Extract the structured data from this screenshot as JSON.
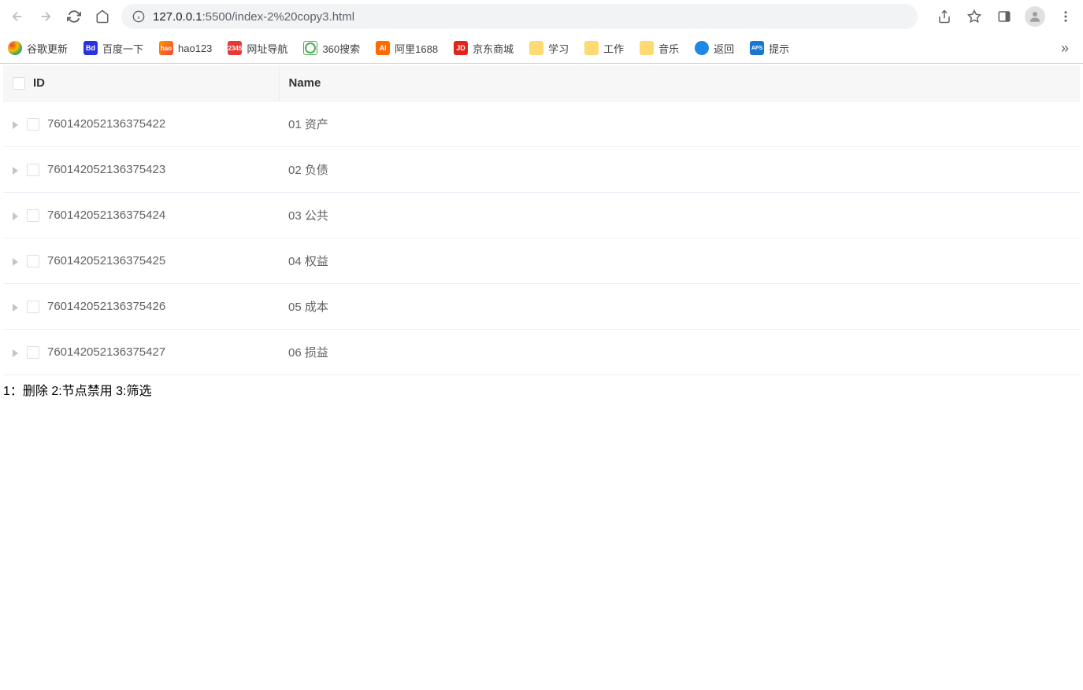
{
  "browser": {
    "url_host": "127.0.0.1",
    "url_port": ":5500",
    "url_path": "/index-2%20copy3.html"
  },
  "bookmarks": [
    {
      "label": "谷歌更新",
      "icon": "chrome"
    },
    {
      "label": "百度一下",
      "icon": "baidu"
    },
    {
      "label": "hao123",
      "icon": "hao123"
    },
    {
      "label": "网址导航",
      "icon": "2345"
    },
    {
      "label": "360搜索",
      "icon": "360"
    },
    {
      "label": "阿里1688",
      "icon": "ali"
    },
    {
      "label": "京东商城",
      "icon": "jd"
    },
    {
      "label": "学习",
      "icon": "folder"
    },
    {
      "label": "工作",
      "icon": "folder"
    },
    {
      "label": "音乐",
      "icon": "folder"
    },
    {
      "label": "返回",
      "icon": "back"
    },
    {
      "label": "提示",
      "icon": "aps"
    }
  ],
  "table": {
    "columns": {
      "id": "ID",
      "name": "Name"
    },
    "rows": [
      {
        "id": "760142052136375422",
        "name": "01 资产"
      },
      {
        "id": "760142052136375423",
        "name": "02 负债"
      },
      {
        "id": "760142052136375424",
        "name": "03 公共"
      },
      {
        "id": "760142052136375425",
        "name": "04 权益"
      },
      {
        "id": "760142052136375426",
        "name": "05 成本"
      },
      {
        "id": "760142052136375427",
        "name": "06 损益"
      }
    ]
  },
  "footer": "1：删除 2:节点禁用 3:筛选"
}
